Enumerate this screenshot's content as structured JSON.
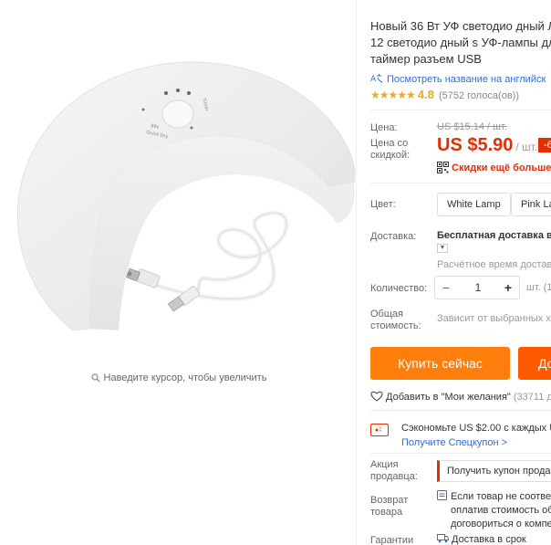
{
  "gallery": {
    "zoom_hint": "Наведите курсор, чтобы увеличить",
    "lamp_labels": {
      "quick_dry": "99s\nQuick Dry",
      "timer": "Timer"
    }
  },
  "product": {
    "title_lines": [
      "Новый 36 Вт УФ светодио дный Л",
      "12 светодио дный s УФ-лампы дл",
      "таймер разъем USB"
    ],
    "translate_link": "Посмотреть название на английск",
    "rating_value": "4.8",
    "rating_stars": 5,
    "votes": "(5752 голоса(ов))"
  },
  "pricing": {
    "price_label": "Цена:",
    "old_price": "US $15.14 / шт.",
    "sale_label": "Цена со\nскидкой:",
    "sale_price": "US $5.90",
    "unit": "/ шт.",
    "discount_badge": "-6",
    "coupon_text": "Скидки ещё больше в"
  },
  "options": {
    "color_label": "Цвет:",
    "colors": [
      "White Lamp",
      "Pink La"
    ],
    "delivery_label": "Доставка:",
    "delivery_value": "Бесплатная доставка в I",
    "delivery_time": "Расчётное время доставк",
    "qty_label": "Количество:",
    "qty_value": "1",
    "qty_minus": "−",
    "qty_plus": "+",
    "qty_unit": "шт. (16",
    "total_label": "Общая\nстоимость:",
    "total_value": "Зависит от выбранных хар"
  },
  "actions": {
    "buy_now": "Купить сейчас",
    "add_to_cart": "До",
    "wishlist": "Добавить в \"Мои желания\"",
    "wishlist_count": "(33711 до"
  },
  "promo": {
    "save_text": "Сэкономьте US $2.00 с каждых US",
    "coupon_link": "Получите Спецкупон >",
    "seller_label": "Акция\nпродавца:",
    "seller_button": "Получить купон продав"
  },
  "returns": {
    "label": "Возврат\nтовара",
    "lines": [
      "Если товар не соответ",
      "оплатив стоимость об",
      "договориться о компе"
    ]
  },
  "guarantee": {
    "label": "Гарантии",
    "value": "Доставка в срок"
  },
  "colors": {
    "price_red": "#e62e04",
    "buy_orange": "#ff7e0c",
    "cart_orange": "#ff5a00",
    "link_blue": "#2e6fd1",
    "star": "#f5a623"
  }
}
